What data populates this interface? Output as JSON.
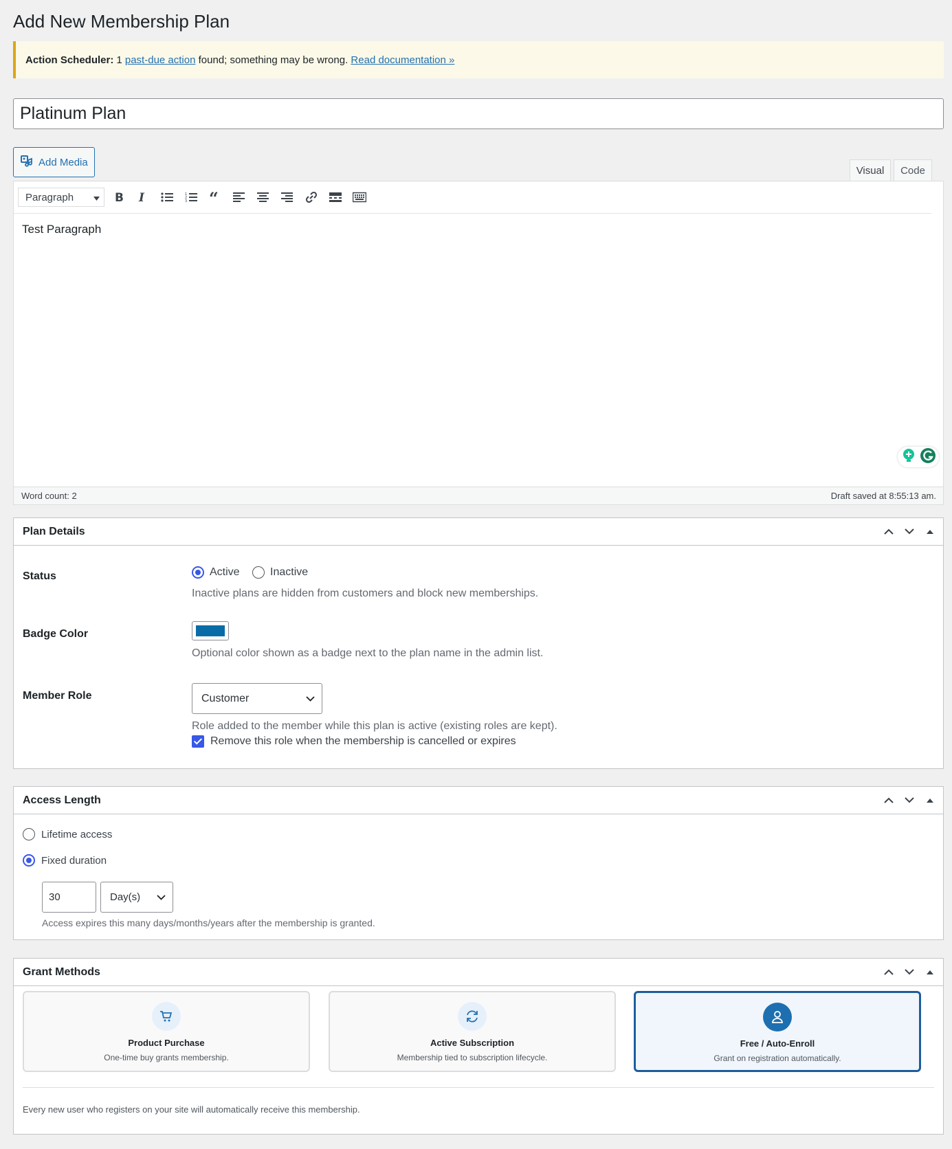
{
  "page": {
    "title": "Add New Membership Plan"
  },
  "notice": {
    "label": "Action Scheduler:",
    "count": "1",
    "link_text": "past-due action",
    "middle_text": "found; something may be wrong.",
    "doc_link": "Read documentation »"
  },
  "post_title": "Platinum Plan",
  "editor": {
    "add_media": "Add Media",
    "tab_visual": "Visual",
    "tab_code": "Code",
    "format": "Paragraph",
    "content": "Test Paragraph",
    "word_count": "Word count: 2",
    "draft_saved": "Draft saved at 8:55:13 am."
  },
  "plan_details": {
    "title": "Plan Details",
    "status_label": "Status",
    "status_options": [
      "Active",
      "Inactive"
    ],
    "status_selected": "Active",
    "status_desc": "Inactive plans are hidden from customers and block new memberships.",
    "badge_label": "Badge Color",
    "badge_color": "#0a6ca7",
    "badge_desc": "Optional color shown as a badge next to the plan name in the admin list.",
    "role_label": "Member Role",
    "role_value": "Customer",
    "role_desc": "Role added to the member while this plan is active (existing roles are kept).",
    "role_remove_checked": true,
    "role_remove_label": "Remove this role when the membership is cancelled or expires"
  },
  "access_length": {
    "title": "Access Length",
    "lifetime_label": "Lifetime access",
    "fixed_label": "Fixed duration",
    "selected": "Fixed duration",
    "duration_value": "30",
    "duration_unit": "Day(s)",
    "desc": "Access expires this many days/months/years after the membership is granted."
  },
  "grant_methods": {
    "title": "Grant Methods",
    "cards": [
      {
        "title": "Product Purchase",
        "desc": "One-time buy grants membership.",
        "icon": "cart-icon"
      },
      {
        "title": "Active Subscription",
        "desc": "Membership tied to subscription lifecycle.",
        "icon": "refresh-icon"
      },
      {
        "title": "Free / Auto-Enroll",
        "desc": "Grant on registration automatically.",
        "icon": "user-icon"
      }
    ],
    "selected": "Free / Auto-Enroll",
    "note": "Every new user who registers on your site will automatically receive this membership."
  },
  "colors": {
    "accent": "#3858e9",
    "link": "#2271b1",
    "notice_border": "#dba617",
    "selected_card": "#1d5d9e"
  }
}
